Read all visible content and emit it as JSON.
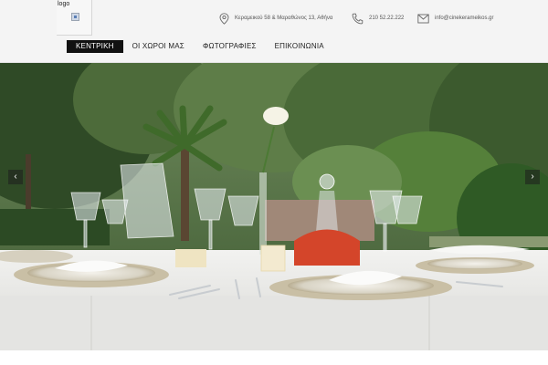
{
  "header": {
    "logo_text": "logo",
    "logo_icon": "broken-image-icon",
    "contact": {
      "address": "Κεραμεικού 58 & Μαραθώνος 13, Αθήνα",
      "address_icon": "map-pin-icon",
      "phone": "210 52.22.222",
      "phone_icon": "phone-icon",
      "email": "info@cinekerameikos.gr",
      "email_icon": "envelope-icon"
    }
  },
  "nav": {
    "items": [
      {
        "label": "ΚΕΝΤΡΙΚΗ",
        "active": true
      },
      {
        "label": "ΟΙ ΧΩΡΟΙ ΜΑΣ",
        "active": false
      },
      {
        "label": "ΦΩΤΟΓΡΑΦΙΕΣ",
        "active": false
      },
      {
        "label": "ΕΠΙΚΟΙΝΩΝΙΑ",
        "active": false
      }
    ]
  },
  "slider": {
    "prev_label": "‹",
    "next_label": "›"
  },
  "colors": {
    "nav_active_bg": "#111111",
    "header_bg": "#f4f4f4",
    "icon_color": "#666666"
  }
}
